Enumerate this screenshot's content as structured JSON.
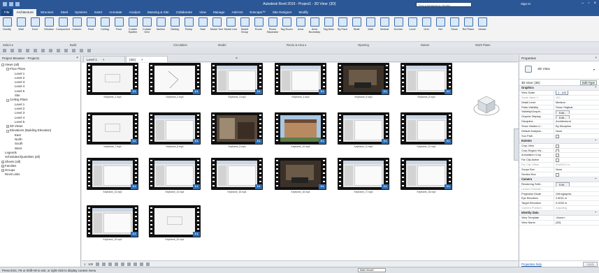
{
  "titlebar": {
    "title": "Autodesk Revit 2019 - Project1 - 3D View: {3D}",
    "search_placeholder": "Type a keyword or phrase",
    "sign_in": "Sign In"
  },
  "ribbon_tabs": [
    "File",
    "Architecture",
    "Structure",
    "Steel",
    "Systems",
    "Insert",
    "Annotate",
    "Analyze",
    "Massing & Site",
    "Collaborate",
    "View",
    "Manage",
    "Add-Ins",
    "Enscape™",
    "Site Designer",
    "Modify"
  ],
  "active_tab_index": 1,
  "tools": [
    {
      "label": "Modify",
      "icon": "modify-icon"
    },
    {
      "label": "Wall",
      "icon": "wall-icon"
    },
    {
      "label": "Door",
      "icon": "door-icon"
    },
    {
      "label": "Window",
      "icon": "window-icon"
    },
    {
      "label": "Component",
      "icon": "component-icon"
    },
    {
      "label": "Column",
      "icon": "column-icon"
    },
    {
      "label": "Roof",
      "icon": "roof-icon"
    },
    {
      "label": "Ceiling",
      "icon": "ceiling-icon"
    },
    {
      "label": "Floor",
      "icon": "floor-icon"
    },
    {
      "label": "Curtain System",
      "icon": "curtain-system-icon"
    },
    {
      "label": "Curtain Grid",
      "icon": "curtain-grid-icon"
    },
    {
      "label": "Mullion",
      "icon": "mullion-icon"
    },
    {
      "label": "Railing",
      "icon": "railing-icon"
    },
    {
      "label": "Ramp",
      "icon": "ramp-icon"
    },
    {
      "label": "Stair",
      "icon": "stair-icon"
    },
    {
      "label": "Model Text",
      "icon": "model-text-icon"
    },
    {
      "label": "Model Line",
      "icon": "model-line-icon"
    },
    {
      "label": "Model Group",
      "icon": "model-group-icon"
    },
    {
      "label": "Room",
      "icon": "room-icon"
    },
    {
      "label": "Room Separator",
      "icon": "room-separator-icon"
    },
    {
      "label": "Tag Room",
      "icon": "tag-room-icon"
    },
    {
      "label": "Area",
      "icon": "area-icon"
    },
    {
      "label": "Area Boundary",
      "icon": "area-boundary-icon"
    },
    {
      "label": "Tag Area",
      "icon": "tag-area-icon"
    },
    {
      "label": "By Face",
      "icon": "by-face-icon"
    },
    {
      "label": "Shaft",
      "icon": "shaft-icon"
    },
    {
      "label": "Wall",
      "icon": "wall-opening-icon"
    },
    {
      "label": "Vertical",
      "icon": "vertical-icon"
    },
    {
      "label": "Dormer",
      "icon": "dormer-icon"
    },
    {
      "label": "Level",
      "icon": "level-icon"
    },
    {
      "label": "Grid",
      "icon": "grid-icon"
    },
    {
      "label": "Set",
      "icon": "set-icon"
    },
    {
      "label": "Show",
      "icon": "show-icon"
    },
    {
      "label": "Ref Plane",
      "icon": "ref-plane-icon"
    },
    {
      "label": "Viewer",
      "icon": "viewer-icon"
    }
  ],
  "groups": [
    "Select ▾",
    "Build",
    "Circulation",
    "Model",
    "Room & Area ▾",
    "Opening",
    "Datum",
    "Work Plane"
  ],
  "project_browser": {
    "title": "Project Browser - Project1",
    "nodes": [
      {
        "text": "Views (all)",
        "lv": 0,
        "t": "-"
      },
      {
        "text": "Floor Plans",
        "lv": 1,
        "t": "-"
      },
      {
        "text": "Level 1",
        "lv": 2,
        "t": ""
      },
      {
        "text": "Level 2",
        "lv": 2,
        "t": ""
      },
      {
        "text": "Level 3",
        "lv": 2,
        "t": ""
      },
      {
        "text": "Level 4",
        "lv": 2,
        "t": ""
      },
      {
        "text": "Level 5",
        "lv": 2,
        "t": ""
      },
      {
        "text": "Site",
        "lv": 2,
        "t": ""
      },
      {
        "text": "Ceiling Plans",
        "lv": 1,
        "t": "-"
      },
      {
        "text": "Level 1",
        "lv": 2,
        "t": ""
      },
      {
        "text": "Level 2",
        "lv": 2,
        "t": ""
      },
      {
        "text": "Level 3",
        "lv": 2,
        "t": ""
      },
      {
        "text": "Level 4",
        "lv": 2,
        "t": ""
      },
      {
        "text": "Level 5",
        "lv": 2,
        "t": ""
      },
      {
        "text": "3D Views",
        "lv": 1,
        "t": "+"
      },
      {
        "text": "Elevations (Building Elevation)",
        "lv": 1,
        "t": "-"
      },
      {
        "text": "East",
        "lv": 2,
        "t": ""
      },
      {
        "text": "North",
        "lv": 2,
        "t": ""
      },
      {
        "text": "South",
        "lv": 2,
        "t": ""
      },
      {
        "text": "West",
        "lv": 2,
        "t": ""
      },
      {
        "text": "Legends",
        "lv": 0,
        "t": ""
      },
      {
        "text": "Schedules/Quantities (all)",
        "lv": 0,
        "t": ""
      },
      {
        "text": "Sheets (all)",
        "lv": 0,
        "t": "+"
      },
      {
        "text": "Families",
        "lv": 0,
        "t": "+"
      },
      {
        "text": "Groups",
        "lv": 0,
        "t": "+"
      },
      {
        "text": "Revit Links",
        "lv": 0,
        "t": ""
      }
    ]
  },
  "view_tabs": [
    "Level 1",
    "{3D}"
  ],
  "videos": [
    {
      "name": "Keyframe_1.mp4",
      "scene": "white"
    },
    {
      "name": "Keyframe_2.mp4",
      "scene": "lines"
    },
    {
      "name": "Keyframe_3.mp4",
      "scene": "ui"
    },
    {
      "name": "Keyframe_4.mp4",
      "scene": "ui"
    },
    {
      "name": "Keyframe_5.mp4",
      "scene": "room"
    },
    {
      "name": "Keyframe_6.mp4",
      "scene": "ui"
    },
    {
      "name": "Keyframe_7.mp4",
      "scene": "white"
    },
    {
      "name": "Keyframe_8.mp4",
      "scene": "ui"
    },
    {
      "name": "Keyframe_9.mp4",
      "scene": "photo"
    },
    {
      "name": "Keyframe_10.mp4",
      "scene": "building"
    },
    {
      "name": "Keyframe_11.mp4",
      "scene": "ui"
    },
    {
      "name": "Keyframe_12.mp4",
      "scene": "ui"
    },
    {
      "name": "Keyframe_13.mp4",
      "scene": "ui"
    },
    {
      "name": "Keyframe_14.mp4",
      "scene": "ui"
    },
    {
      "name": "Keyframe_15.mp4",
      "scene": "ui"
    },
    {
      "name": "Keyframe_16.mp4",
      "scene": "room"
    },
    {
      "name": "Keyframe_17.mp4",
      "scene": "ui"
    },
    {
      "name": "Keyframe_18.mp4",
      "scene": "ui"
    },
    {
      "name": "Keyframe_19.mp4",
      "scene": "ui"
    },
    {
      "name": "Keyframe_20.mp4",
      "scene": "white"
    }
  ],
  "view_bar": {
    "scale": "1 : 100"
  },
  "properties": {
    "title": "Properties",
    "type_name": "3D View",
    "instance": "3D View: {3D}",
    "edit_type": "Edit Type",
    "rows": [
      {
        "cat": "Graphics"
      },
      {
        "k": "View Scale",
        "v": "1 : 100",
        "box": true
      },
      {
        "k": "Scale Value 1:",
        "v": "100",
        "grey": true
      },
      {
        "k": "Detail Level",
        "v": "Medium"
      },
      {
        "k": "Parts Visibility",
        "v": "Show Original"
      },
      {
        "k": "Visibility/Graphi...",
        "v": "Edit...",
        "btn": true
      },
      {
        "k": "Graphic Display...",
        "v": "Edit...",
        "btn": true
      },
      {
        "k": "Discipline",
        "v": "Architectural"
      },
      {
        "k": "Show Hidden Li...",
        "v": "By Discipline"
      },
      {
        "k": "Default Analysis...",
        "v": "None"
      },
      {
        "k": "Sun Path",
        "v": "",
        "chk": true
      },
      {
        "cat": "Extents"
      },
      {
        "k": "Crop View",
        "v": "",
        "chk": true
      },
      {
        "k": "Crop Region Vis...",
        "v": "",
        "chk": true
      },
      {
        "k": "Annotation Crop",
        "v": "",
        "chk": true
      },
      {
        "k": "Far Clip Active",
        "v": "",
        "chk": true
      },
      {
        "k": "Far Clip Offset",
        "v": "304800.0 m",
        "grey": true
      },
      {
        "k": "Scope Box",
        "v": "None"
      },
      {
        "k": "Section Box",
        "v": "",
        "chk": true
      },
      {
        "cat": "Camera"
      },
      {
        "k": "Rendering Setti...",
        "v": "Edit...",
        "btn": true
      },
      {
        "k": "Locked Orientat...",
        "v": "",
        "grey": true
      },
      {
        "k": "Projection Mode",
        "v": "Orthographic"
      },
      {
        "k": "Eye Elevation",
        "v": "2.8021 m"
      },
      {
        "k": "Target Elevation",
        "v": "0.0000 m"
      },
      {
        "k": "Camera Position",
        "v": "Adjusting",
        "grey": true
      },
      {
        "cat": "Identity Data"
      },
      {
        "k": "View Template",
        "v": "<None>"
      },
      {
        "k": "View Name",
        "v": "{3D}"
      }
    ],
    "help": "Properties help",
    "apply": "Apply"
  },
  "status": {
    "text": "Press ESC, F8 or Shift+W to exit, or right-click to display context menu",
    "model": "Main Model"
  }
}
